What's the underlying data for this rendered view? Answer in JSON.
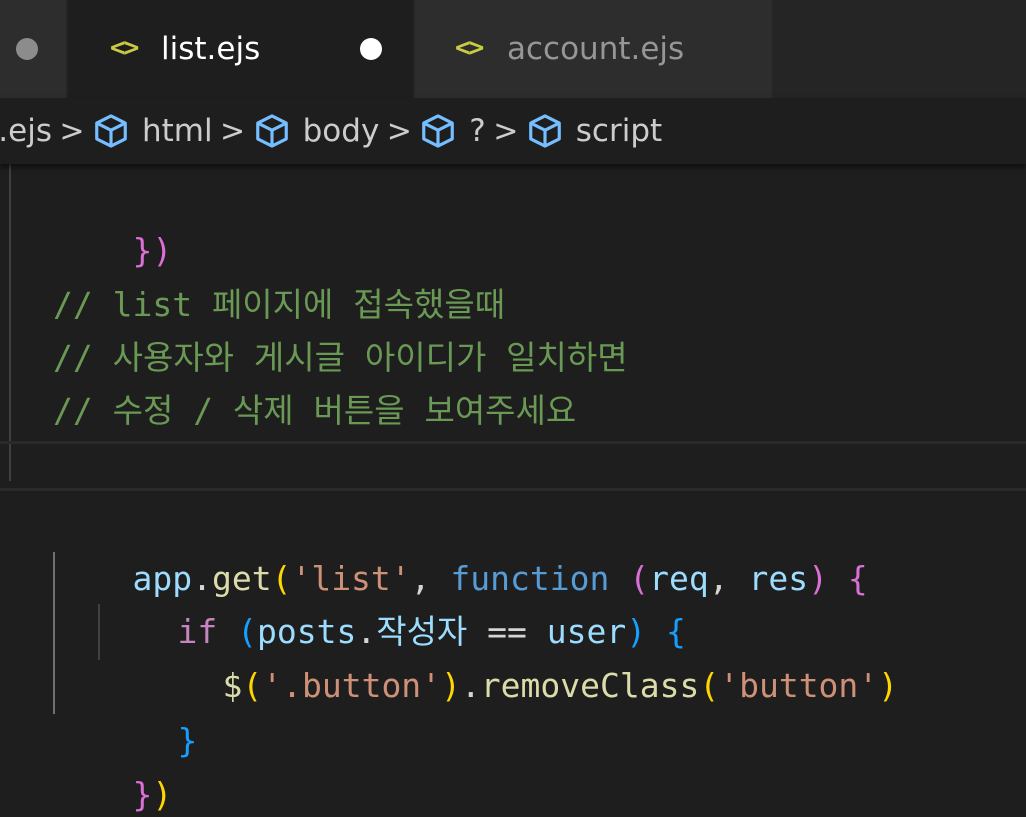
{
  "tabs": [
    {
      "label": "",
      "icon": "dot-icon",
      "dirty": true
    },
    {
      "label": "list.ejs",
      "icon": "code-brackets-icon",
      "active": true,
      "dirty": true
    },
    {
      "label": "account.ejs",
      "icon": "code-brackets-icon",
      "active": false
    }
  ],
  "icons": {
    "file": "<>"
  },
  "breadcrumb": {
    "items": [
      {
        "label": "st.ejs",
        "icon": null
      },
      {
        "label": "html",
        "icon": "cube-icon"
      },
      {
        "label": "body",
        "icon": "cube-icon"
      },
      {
        "label": "?",
        "icon": "cube-icon"
      },
      {
        "label": "script",
        "icon": "cube-icon"
      }
    ],
    "separator": ">"
  },
  "colors": {
    "comment": "#6a9955",
    "variable": "#9cdcfe",
    "function": "#dcdcaa",
    "string": "#ce9178",
    "keyword": "#569cd6",
    "control": "#c586c0",
    "bracket1": "#ffd700",
    "bracket2": "#da70d6",
    "bracket3": "#179fff",
    "accent_icon": "#cbcb41",
    "breadcrumb_icon": "#75beff"
  },
  "code": {
    "l1": {
      "p1": "})"
    },
    "l3": "// list 페이지에 접속했을때",
    "l4": "// 사용자와 게시글 아이디가 일치하면",
    "l5": "// 수정 / 삭제 버튼을 보여주세요",
    "l7": {
      "app": "app",
      "dot": ".",
      "get": "get",
      "op": "(",
      "str": "'list'",
      "comma": ", ",
      "kw": "function",
      "sp": " ",
      "op2": "(",
      "req": "req",
      "comma2": ", ",
      "res": "res",
      "cp2": ")",
      "sp2": " ",
      "ob": "{"
    },
    "l8": {
      "kw": "if",
      "sp": " ",
      "op": "(",
      "posts": "posts",
      "dot": ".",
      "prop": "작성자",
      "eq": " == ",
      "user": "user",
      "cp": ")",
      "sp2": " ",
      "ob": "{"
    },
    "l9": {
      "fn": "$",
      "op": "(",
      "str": "'.button'",
      "cp": ")",
      "dot": ".",
      "method": "removeClass",
      "op2": "(",
      "str2": "'button'",
      "cp2": ")"
    },
    "l10": "}",
    "l11": {
      "cb": "}",
      "cp": ")"
    }
  }
}
